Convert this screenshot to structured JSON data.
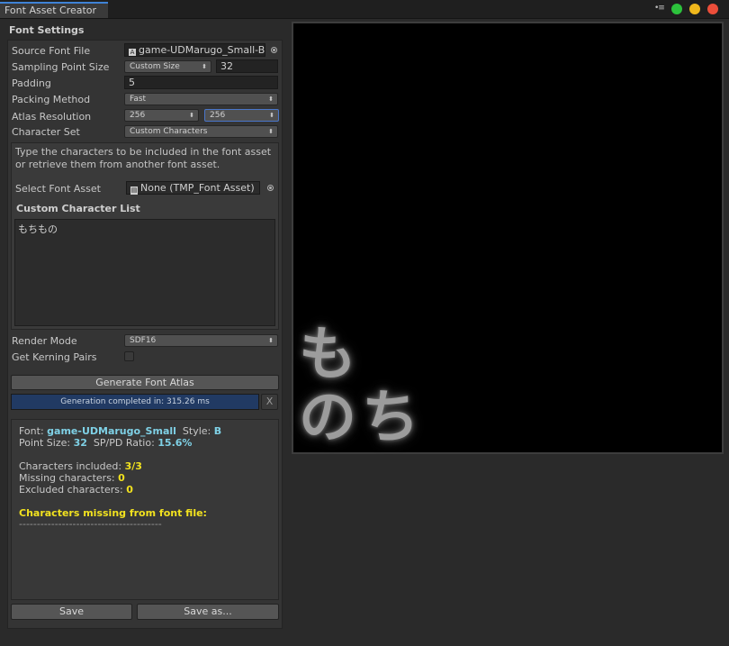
{
  "window": {
    "tab_title": "Font Asset Creator",
    "menu_icon": "•≡"
  },
  "window_dots": {
    "green": "#2cc23c",
    "yellow": "#f0b81c",
    "red": "#ec4e3a"
  },
  "settings": {
    "section_title": "Font Settings",
    "source_font": {
      "label": "Source Font File",
      "value": "game-UDMarugo_Small-B"
    },
    "sampling": {
      "label": "Sampling Point Size",
      "mode": "Custom Size",
      "value": "32"
    },
    "padding": {
      "label": "Padding",
      "value": "5"
    },
    "packing": {
      "label": "Packing Method",
      "value": "Fast"
    },
    "atlas": {
      "label": "Atlas Resolution",
      "width": "256",
      "height": "256"
    },
    "charset": {
      "label": "Character Set",
      "value": "Custom Characters"
    },
    "help_text": "Type the characters to be included in the font asset or retrieve them from another font asset.",
    "select_font_asset": {
      "label": "Select Font Asset",
      "value": "None (TMP_Font Asset)"
    },
    "custom_list": {
      "label": "Custom Character List",
      "value": "もちもの"
    },
    "render_mode": {
      "label": "Render Mode",
      "value": "SDF16"
    },
    "kerning": {
      "label": "Get Kerning Pairs"
    }
  },
  "actions": {
    "generate": "Generate Font Atlas",
    "progress_text": "Generation completed in: 315.26 ms",
    "close": "X",
    "save": "Save",
    "save_as": "Save as..."
  },
  "info": {
    "font_prefix": "Font: ",
    "font_name": "game-UDMarugo_Small",
    "style_prefix": "Style: ",
    "style": "B",
    "point_size_prefix": "Point Size: ",
    "point_size": "32",
    "ratio_prefix": "SP/PD Ratio: ",
    "ratio": "15.6%",
    "included_prefix": "Characters included: ",
    "included": "3/3",
    "missing_prefix": "Missing characters: ",
    "missing": "0",
    "excluded_prefix": "Excluded characters: ",
    "excluded": "0",
    "missing_header": "Characters missing from font file:",
    "separator": "----------------------------------------"
  },
  "preview": {
    "glyphs": [
      "も",
      "の",
      "ち"
    ]
  }
}
